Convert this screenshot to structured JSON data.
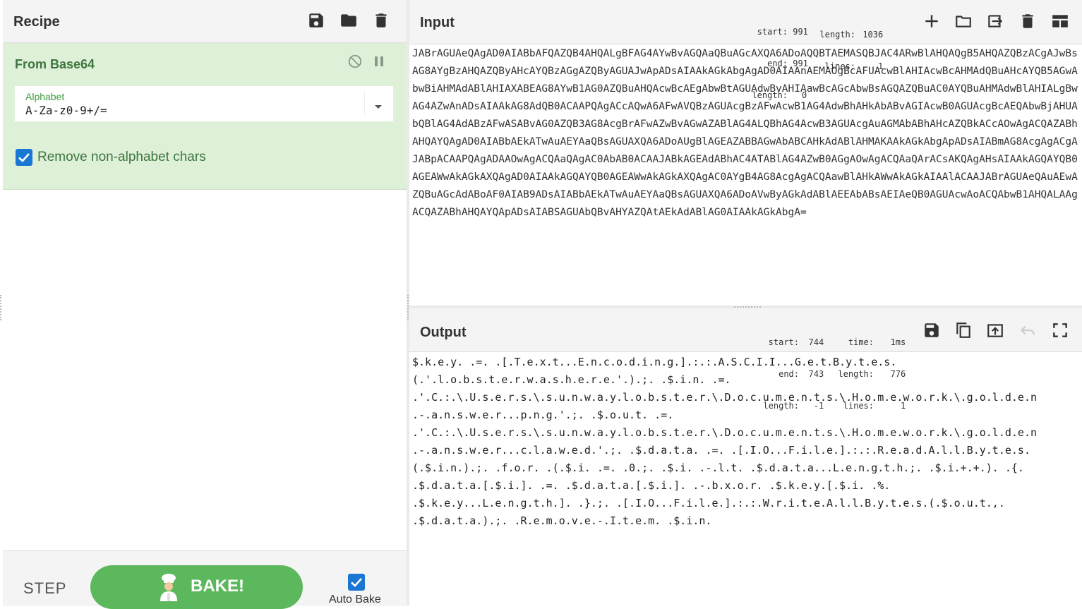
{
  "recipe": {
    "title": "Recipe",
    "icons": [
      "save-icon",
      "folder-open-icon",
      "trash-icon"
    ]
  },
  "operation": {
    "name": "From Base64",
    "alphabet_label": "Alphabet",
    "alphabet_value": "A-Za-z0-9+/=",
    "remove_non_alphabet_label": "Remove non-alphabet chars",
    "remove_non_alphabet_checked": true
  },
  "controls": {
    "step_label": "STEP",
    "bake_label": "BAKE!",
    "auto_bake_label": "Auto Bake",
    "auto_bake_checked": true
  },
  "input": {
    "title": "Input",
    "stats": {
      "start_label": "start:",
      "start": "991",
      "end_label": "end:",
      "end": "991",
      "sel_length_label": "length:",
      "sel_length": "0",
      "length_label": "length:",
      "length": "1036",
      "lines_label": "lines:",
      "lines": "1"
    },
    "text": "JABrAGUAeQAgAD0AIABbAFQAZQB4AHQALgBFAG4AYwBvAGQAaQBuAGcAXQA6ADoAQQBTAEMASQBJAC4ARwBlAHQAQgB5AHQAZQBzACgAJwBsAG8AYgBzAHQAZQByAHcAYQBzAGgAZQByAGUAJwApADsAIAAkAGkAbgAgAD0AIAAnAEMAOgBcAFUAcwBlAHIAcwBcAHMAdQBuAHcAYQB5AGwAbwBiAHMAdABlAHIAXABEAG8AYwB1AG0AZQBuAHQAcwBcAEgAbwBtAGUAdwBvAHIAawBcAGcAbwBsAGQAZQBuAC0AYQBuAHMAdwBlAHIALgBwAG4AZwAnADsAIAAkAG8AdQB0ACAAPQAgACcAQwA6AFwAVQBzAGUAcgBzAFwAcwB1AG4AdwBhAHkAbABvAGIAcwB0AGUAcgBcAEQAbwBjAHUAbQBlAG4AdABzAFwASABvAG0AZQB3AG8AcgBrAFwAZwBvAGwAZABlAG4ALQBhAG4AcwB3AGUAcgAuAGMAbABhAHcAZQBkACcAOwAgACQAZABhAHQAYQAgAD0AIABbAEkATwAuAEYAaQBsAGUAXQA6ADoAUgBlAGEAZABBAGwAbABCAHkAdABlAHMAKAAkAGkAbgApADsAIABmAG8AcgAgACgAJABpACAAPQAgADAAOwAgACQAaQAgAC0AbAB0ACAAJABkAGEAdABhAC4ATABlAG4AZwB0AGgAOwAgACQAaQArACsAKQAgAHsAIAAkAGQAYQB0AGEAWwAkAGkAXQAgAD0AIAAkAGQAYQB0AGEAWwAkAGkAXQAgAC0AYgB4AG8AcgAgACQAawBlAHkAWwAkAGkAIAAlACAAJABrAGUAeQAuAEwAZQBuAGcAdABoAF0AIAB9ADsAIABbAEkATwAuAEYAaQBsAGUAXQA6ADoAVwByAGkAdABlAEEAbABsAEIAeQB0AGUAcwAoACQAbwB1AHQALAAgACQAZABhAHQAYQApADsAIABSAGUAbQBvAHYAZQAtAEkAdABlAG0AIAAkAGkAbgA="
  },
  "output": {
    "title": "Output",
    "stats": {
      "start_label": "start:",
      "start": "744",
      "end_label": "end:",
      "end": "743",
      "sel_length_label": "length:",
      "sel_length": "-1",
      "time_label": "time:",
      "time": "1ms",
      "length_label": "length:",
      "length": "776",
      "lines_label": "lines:",
      "lines": "1"
    },
    "text": "$.k.e.y. .=. .[.T.e.x.t...E.n.c.o.d.i.n.g.].:.:.A.S.C.I.I...G.e.t.B.y.t.e.s.\n(.'.l.o.b.s.t.e.r.w.a.s.h.e.r.e.'.).;. .$.i.n. .=.\n.'.C.:.\\.U.s.e.r.s.\\.s.u.n.w.a.y.l.o.b.s.t.e.r.\\.D.o.c.u.m.e.n.t.s.\\.H.o.m.e.w.o.r.k.\\.g.o.l.d.e.n\n.-.a.n.s.w.e.r...p.n.g.'.;. .$.o.u.t. .=.\n.'.C.:.\\.U.s.e.r.s.\\.s.u.n.w.a.y.l.o.b.s.t.e.r.\\.D.o.c.u.m.e.n.t.s.\\.H.o.m.e.w.o.r.k.\\.g.o.l.d.e.n\n.-.a.n.s.w.e.r...c.l.a.w.e.d.'.;. .$.d.a.t.a. .=. .[.I.O...F.i.l.e.].:.:.R.e.a.d.A.l.l.B.y.t.e.s.\n(.$.i.n.).;. .f.o.r. .(.$.i. .=. .0.;. .$.i. .-.l.t. .$.d.a.t.a...L.e.n.g.t.h.;. .$.i.+.+.). .{.\n.$.d.a.t.a.[.$.i.]. .=. .$.d.a.t.a.[.$.i.]. .-.b.x.o.r. .$.k.e.y.[.$.i. .%.\n.$.k.e.y...L.e.n.g.t.h.]. .}.;. .[.I.O...F.i.l.e.].:.:.W.r.i.t.e.A.l.l.B.y.t.e.s.(.$.o.u.t.,.\n.$.d.a.t.a.).;. .R.e.m.o.v.e.-.I.t.e.m. .$.i.n."
  }
}
